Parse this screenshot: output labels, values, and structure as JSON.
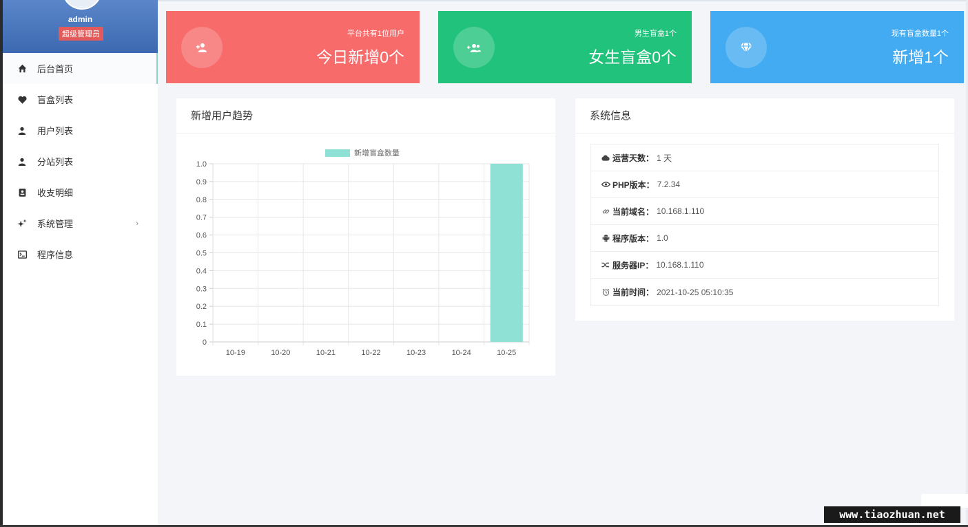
{
  "sidebar": {
    "admin_name": "admin",
    "role": "超级管理员",
    "items": [
      {
        "label": "后台首页",
        "icon": "home-icon"
      },
      {
        "label": "盲盒列表",
        "icon": "heart-icon"
      },
      {
        "label": "用户列表",
        "icon": "user-icon"
      },
      {
        "label": "分站列表",
        "icon": "user-icon"
      },
      {
        "label": "收支明细",
        "icon": "contacts-icon"
      },
      {
        "label": "系统管理",
        "icon": "sparkle-icon"
      },
      {
        "label": "程序信息",
        "icon": "terminal-icon"
      }
    ]
  },
  "cards": [
    {
      "small": "平台共有1位用户",
      "big": "今日新增0个",
      "color": "#f76b6b",
      "icon": "add-user-icon"
    },
    {
      "small": "男生盲盒1个",
      "big": "女生盲盒0个",
      "color": "#21c27b",
      "icon": "users-icon"
    },
    {
      "small": "现有盲盒数量1个",
      "big": "新增1个",
      "color": "#43abf1",
      "icon": "diamond-icon"
    }
  ],
  "chart_panel": {
    "title": "新增用户趋势"
  },
  "chart_data": {
    "type": "bar",
    "categories": [
      "10-19",
      "10-20",
      "10-21",
      "10-22",
      "10-23",
      "10-24",
      "10-25"
    ],
    "series": [
      {
        "name": "新增盲盒数量",
        "values": [
          0,
          0,
          0,
          0,
          0,
          0,
          1
        ],
        "color": "#8fe0d5"
      }
    ],
    "yticks": [
      "1.0",
      "0.9",
      "0.8",
      "0.7",
      "0.6",
      "0.5",
      "0.4",
      "0.3",
      "0.2",
      "0.1",
      "0"
    ],
    "ylim": [
      0,
      1
    ],
    "grid": true,
    "legend": "top-center"
  },
  "info_panel": {
    "title": "系统信息",
    "rows": [
      {
        "label": "运营天数：",
        "value": "1 天",
        "icon": "cloud-icon"
      },
      {
        "label": "PHP版本：",
        "value": "7.2.34",
        "icon": "eye-icon"
      },
      {
        "label": "当前域名：",
        "value": "10.168.1.110",
        "icon": "link-icon"
      },
      {
        "label": "程序版本：",
        "value": "1.0",
        "icon": "android-icon"
      },
      {
        "label": "服务器IP：",
        "value": "10.168.1.110",
        "icon": "shuffle-icon"
      },
      {
        "label": "当前时间：",
        "value": "2021-10-25 05:10:35",
        "icon": "clock-icon"
      }
    ]
  },
  "watermark": "www.tiaozhuan.net"
}
